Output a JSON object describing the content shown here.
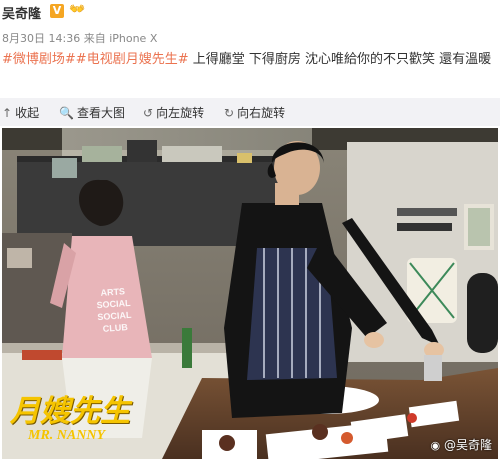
{
  "author": {
    "name": "吴奇隆",
    "badge": "V",
    "emoji": "👐"
  },
  "post_meta": {
    "date": "8月30日",
    "time": "14:36",
    "source": "来自 iPhone X"
  },
  "post": {
    "hashtag1": "#微博剧场#",
    "hashtag2": "#电视剧月嫂先生#",
    "text": " 上得廳堂 下得廚房 沈心唯給你的不只歡笑 還有溫暖"
  },
  "toolbar": {
    "collapse": "收起",
    "view_large": "查看大图",
    "rotate_left": "向左旋转",
    "rotate_right": "向右旋转"
  },
  "photo": {
    "shirt_text": [
      "ARTS",
      "SOCIAL",
      "SOCIAL",
      "CLUB"
    ],
    "logo_cn": "月嫂先生",
    "logo_en": "MR. NANNY",
    "watermark_logo": "weibo",
    "watermark": "@吴奇隆"
  }
}
